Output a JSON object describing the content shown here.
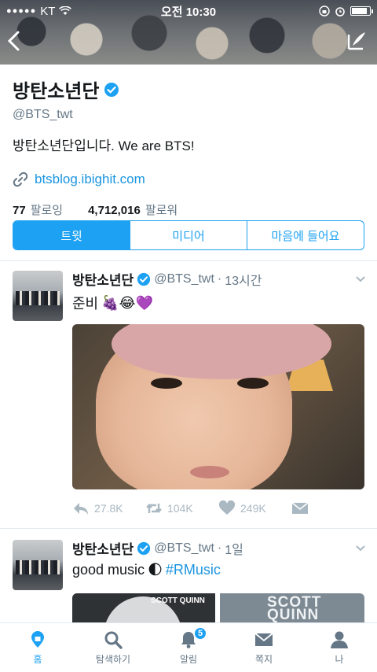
{
  "status_bar": {
    "carrier": "KT",
    "time": "오전 10:30"
  },
  "profile": {
    "name": "방탄소년단",
    "handle": "@BTS_twt",
    "bio": "방탄소년단입니다. We are BTS!",
    "link": "btsblog.ibighit.com",
    "following_count": "77",
    "following_label": "팔로잉",
    "followers_count": "4,712,016",
    "followers_label": "팔로워"
  },
  "tabs": [
    {
      "label": "트윗",
      "active": true
    },
    {
      "label": "미디어",
      "active": false
    },
    {
      "label": "마음에 들어요",
      "active": false
    }
  ],
  "tweets": [
    {
      "name": "방탄소년단",
      "handle": "@BTS_twt",
      "time": "13시간",
      "text": "준비",
      "emoji": "🍇😂💜",
      "replies": "27.8K",
      "retweets": "104K",
      "likes": "249K"
    },
    {
      "name": "방탄소년단",
      "handle": "@BTS_twt",
      "time": "1일",
      "text": "good music",
      "emoji": "🌓",
      "hashtag": "#RMusic",
      "media_text_left": "SCOTT QUINN",
      "media_text_right": "SCOTT QUINN"
    }
  ],
  "bottom_nav": [
    {
      "label": "홈",
      "icon": "home-icon",
      "active": true
    },
    {
      "label": "탐색하기",
      "icon": "search-icon",
      "active": false
    },
    {
      "label": "알림",
      "icon": "bell-icon",
      "active": false,
      "badge": "5"
    },
    {
      "label": "쪽지",
      "icon": "mail-icon",
      "active": false
    },
    {
      "label": "나",
      "icon": "person-icon",
      "active": false
    }
  ],
  "colors": {
    "accent": "#1da1f2",
    "link": "#1b95e0",
    "muted": "#657786"
  }
}
